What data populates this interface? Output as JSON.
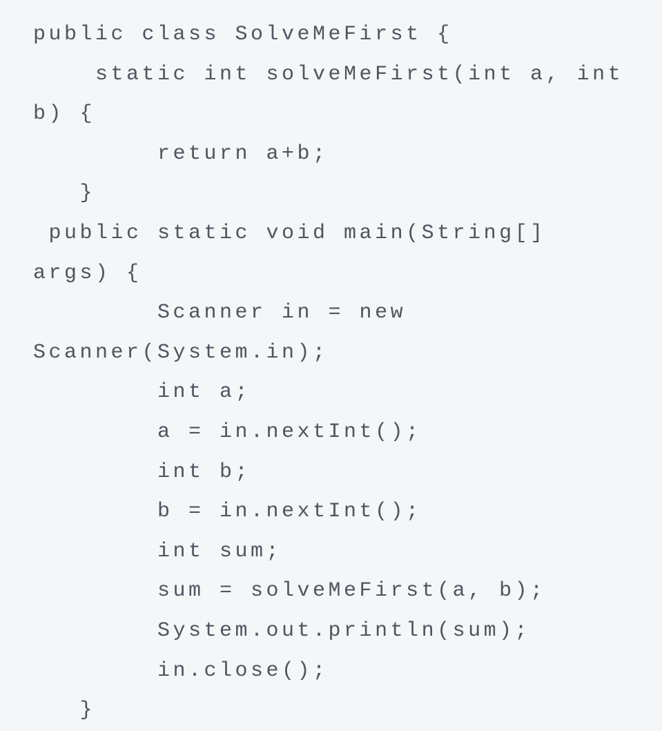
{
  "code": {
    "language": "java",
    "lines": [
      "public class SolveMeFirst {",
      "    static int solveMeFirst(int a, int",
      "b) {",
      "        return a+b;",
      "   }",
      " public static void main(String[]",
      "args) {",
      "        Scanner in = new",
      "Scanner(System.in);",
      "        int a;",
      "        a = in.nextInt();",
      "        int b;",
      "        b = in.nextInt();",
      "        int sum;",
      "        sum = solveMeFirst(a, b);",
      "        System.out.println(sum);",
      "        in.close();",
      "   }"
    ]
  }
}
